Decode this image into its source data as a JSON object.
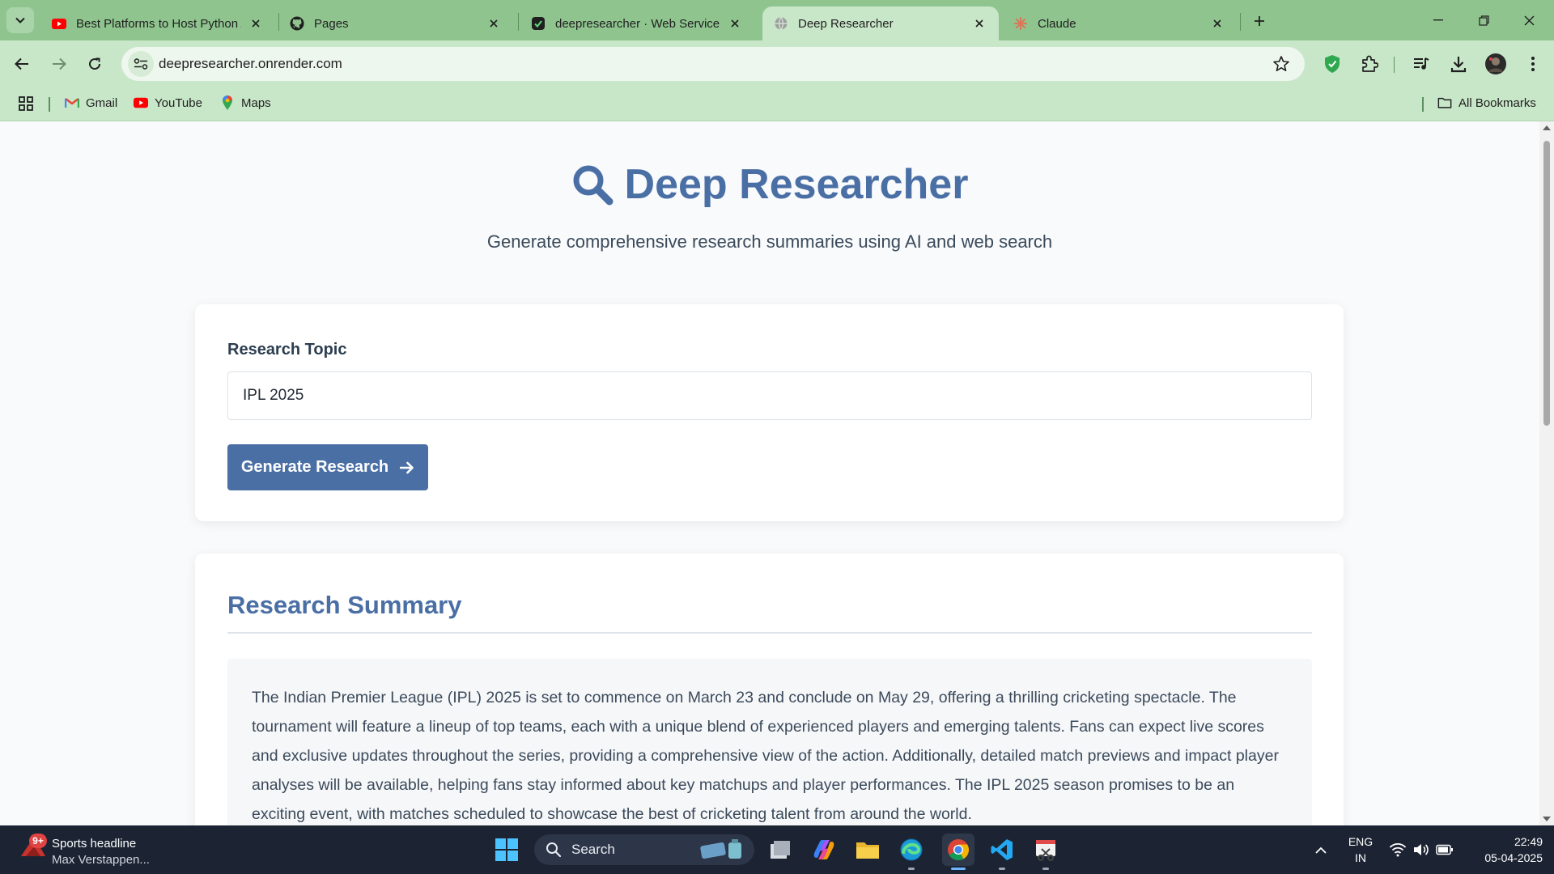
{
  "browser": {
    "tabs": [
      {
        "title": "Best Platforms to Host Python Apps",
        "favicon": "youtube-icon",
        "active": false
      },
      {
        "title": "Pages",
        "favicon": "github-icon",
        "active": false
      },
      {
        "title": "deepresearcher · Web Service",
        "favicon": "render-icon",
        "active": false
      },
      {
        "title": "Deep Researcher",
        "favicon": "globe-icon",
        "active": true
      },
      {
        "title": "Claude",
        "favicon": "claude-icon",
        "active": false
      }
    ],
    "url": "deepresearcher.onrender.com",
    "bookmarks": [
      {
        "label": "Gmail",
        "icon": "gmail-icon"
      },
      {
        "label": "YouTube",
        "icon": "youtube-icon"
      },
      {
        "label": "Maps",
        "icon": "maps-icon"
      }
    ],
    "all_bookmarks_label": "All Bookmarks",
    "theme_color": "#8fc48f"
  },
  "app": {
    "title": "Deep Researcher",
    "subtitle": "Generate comprehensive research summaries using AI and web search",
    "accent_color": "#4a6fa5",
    "form": {
      "label": "Research Topic",
      "value": "IPL 2025",
      "button_label": "Generate Research"
    },
    "summary": {
      "heading": "Research Summary",
      "text": "The Indian Premier League (IPL) 2025 is set to commence on March 23 and conclude on May 29, offering a thrilling cricketing spectacle. The tournament will feature a lineup of top teams, each with a unique blend of experienced players and emerging talents. Fans can expect live scores and exclusive updates throughout the series, providing a comprehensive view of the action. Additionally, detailed match previews and impact player analyses will be available, helping fans stay informed about key matchups and player performances. The IPL 2025 season promises to be an exciting event, with matches scheduled to showcase the best of cricketing talent from around the world."
    }
  },
  "taskbar": {
    "news": {
      "badge": "9+",
      "headline": "Sports headline",
      "subtitle": "Max Verstappen..."
    },
    "search_label": "Search",
    "language": {
      "line1": "ENG",
      "line2": "IN"
    },
    "time": "22:49",
    "date": "05-04-2025"
  }
}
